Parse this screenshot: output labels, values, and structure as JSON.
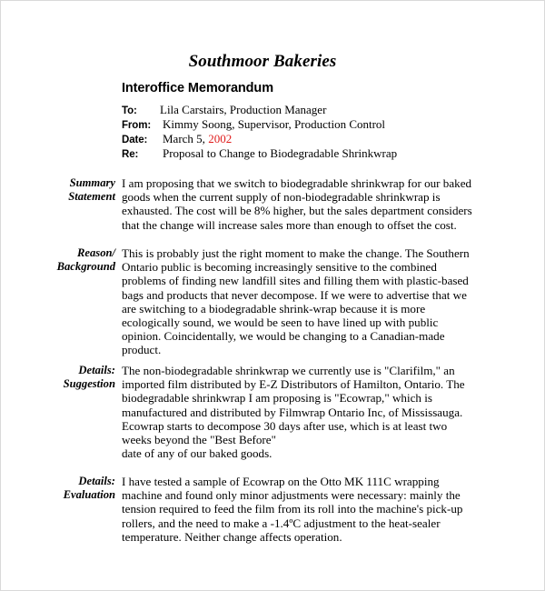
{
  "document": {
    "title": "Southmoor Bakeries",
    "subtitle": "Interoffice Memorandum",
    "accent_color": "#e01b1b",
    "header": {
      "to": {
        "label": "To:",
        "value": "Lila Carstairs, Production Manager"
      },
      "from": {
        "label": "From:",
        "value": "Kimmy Soong, Supervisor, Production Control"
      },
      "date": {
        "label": "Date:",
        "value_prefix": "March 5, ",
        "value_year": "2002"
      },
      "re": {
        "label": "Re:",
        "value": "Proposal to Change to Biodegradable Shrinkwrap"
      }
    },
    "sections": {
      "summary": {
        "label_line1": "Summary",
        "label_line2": "Statement",
        "body": "I am proposing that we switch to biodegradable shrinkwrap for our baked goods when the current supply of non-biodegradable shrinkwrap is exhausted. The cost will be 8% higher, but the sales department considers that the change will increase sales more than enough to offset the cost."
      },
      "reason": {
        "label_line1": "Reason/",
        "label_line2": "Background",
        "body": "This is probably just the right moment to make the change. The Southern Ontario public is becoming increasingly sensitive to the combined problems of finding new landfill sites and filling them with plastic-based bags and products that never decompose. If we were to advertise that we are switching to a biodegradable shrink-wrap because it is more ecologically sound, we would be seen to have lined up with public opinion. Coincidentally, we would be changing to a Canadian-made product."
      },
      "details_suggestion": {
        "label_line1": "Details:",
        "label_line2": "Suggestion",
        "body": "The non-biodegradable shrinkwrap we currently use is \"Clarifilm,\" an imported film distributed by E-Z Distributors of Hamilton, Ontario. The biodegradable shrinkwrap I am proposing is \"Ecowrap,\" which is manufactured and distributed by Filmwrap Ontario Inc, of Mississauga. Ecowrap starts to decompose 30 days after use, which is at least two weeks beyond the \"Best Before\"\ndate of any of our baked goods."
      },
      "details_evaluation": {
        "label_line1": "Details:",
        "label_line2": "Evaluation",
        "body": "I have tested a sample of Ecowrap on the Otto MK 111C wrapping machine and found only minor adjustments were necessary: mainly the tension required to feed the film from its roll into the machine's pick-up rollers, and the need to make a -1.4ºC adjustment to the heat-sealer temperature. Neither change affects operation."
      }
    }
  }
}
